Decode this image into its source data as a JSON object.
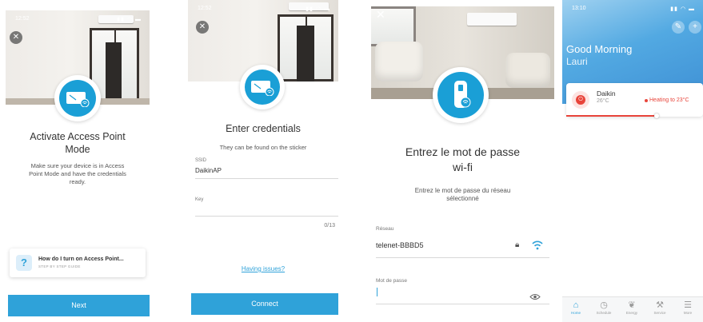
{
  "screens": [
    {
      "status_time": "12:52",
      "title_line1": "Activate Access Point",
      "title_line2": "Mode",
      "body_lines": [
        "Make sure your device is in Access",
        "Point Mode and have the credentials",
        "ready."
      ],
      "help_title": "How do I turn on Access Point...",
      "help_subtitle": "STEP BY STEP GUIDE",
      "help_icon": "?",
      "next_label": "Next"
    },
    {
      "status_time": "12:52",
      "title": "Enter credentials",
      "subtitle": "They can be found on the sticker",
      "ssid_label": "SSID",
      "ssid_value": "DaikinAP",
      "key_label": "Key",
      "key_counter": "0/13",
      "having_issues": "Having issues?",
      "connect_label": "Connect"
    },
    {
      "title_line1": "Entrez le mot de passe",
      "title_line2": "wi-fi",
      "subtitle_line1": "Entrez le mot de passe du réseau",
      "subtitle_line2": "sélectionné",
      "network_label": "Réseau",
      "network_value": "telenet-BBBD5",
      "password_label": "Mot de passe"
    },
    {
      "status_time": "13:10",
      "greeting": "Good Morning",
      "user_name": "Lauri",
      "device_name": "Daikin",
      "device_temp": "26°C",
      "device_status": "Heating to 23°C",
      "tabs": [
        {
          "label": "Home",
          "icon": "home-icon"
        },
        {
          "label": "Schedule",
          "icon": "clock-icon"
        },
        {
          "label": "Energy",
          "icon": "leaf-icon"
        },
        {
          "label": "Service",
          "icon": "wrench-icon"
        },
        {
          "label": "More",
          "icon": "menu-icon"
        }
      ]
    }
  ],
  "colors": {
    "accent": "#2fa2d9",
    "heating": "#e8443a",
    "badge": "#1a9fd6"
  }
}
